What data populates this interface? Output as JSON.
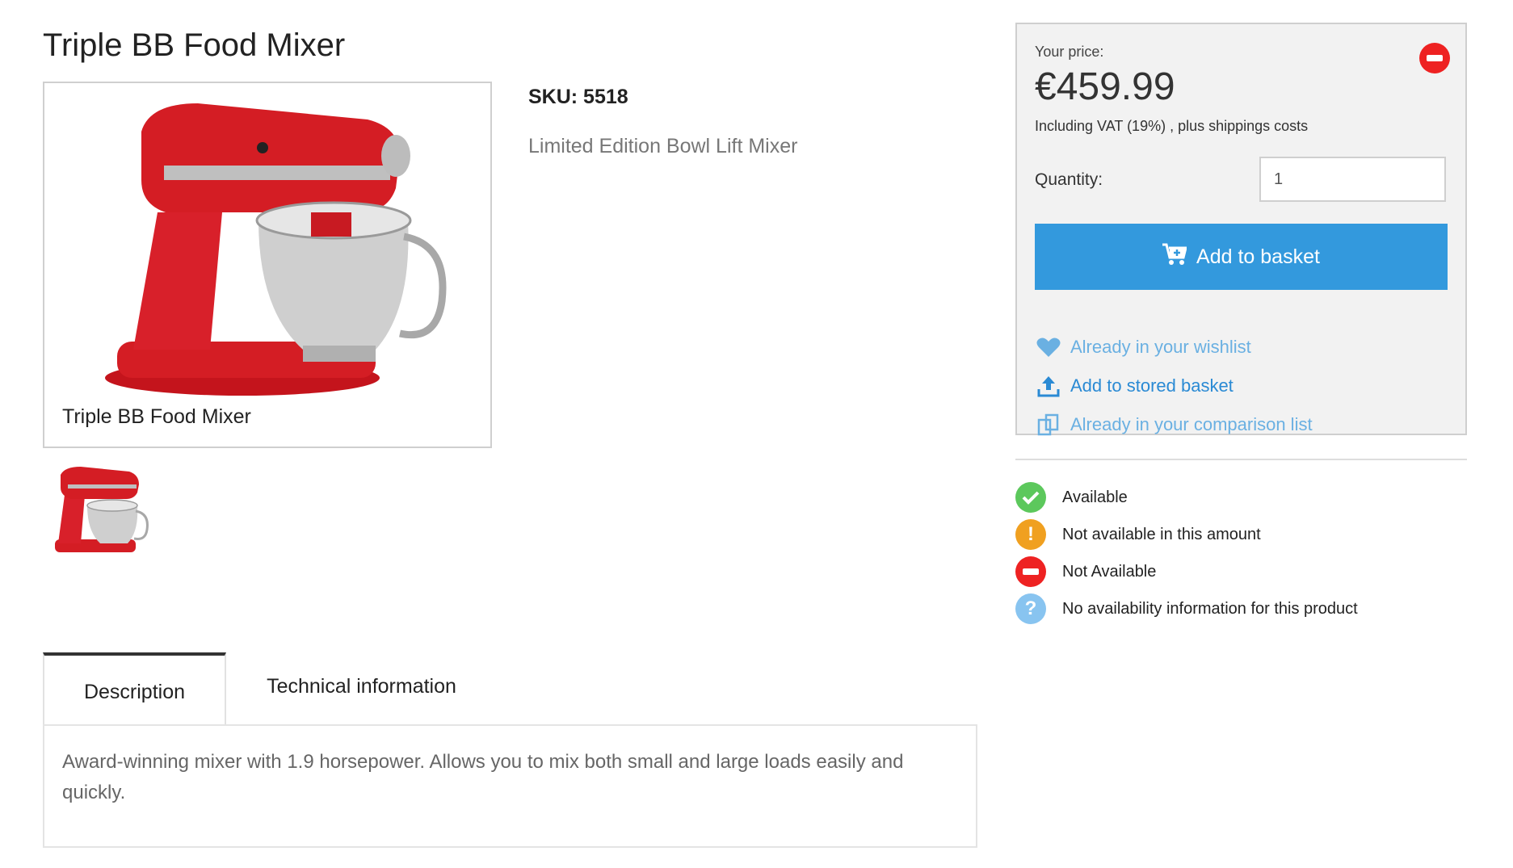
{
  "product": {
    "title": "Triple BB Food Mixer",
    "image_caption": "Triple BB Food Mixer",
    "sku": "SKU: 5518",
    "subtitle": "Limited Edition Bowl Lift Mixer"
  },
  "price_panel": {
    "price_label": "Your price:",
    "price": "€459.99",
    "vat_note": "Including VAT (19%) , plus shippings costs",
    "quantity_label": "Quantity:",
    "quantity_value": "1",
    "add_to_basket": "Add to basket",
    "wishlist_link": "Already in your wishlist",
    "stored_basket_link": "Add to stored basket",
    "comparison_link": "Already in your comparison list",
    "status_icon": "not-available-icon"
  },
  "availability_legend": [
    {
      "label": "Available",
      "icon": "check-icon",
      "color": "#5cc85c"
    },
    {
      "label": "Not available in this amount",
      "icon": "exclamation-icon",
      "color": "#f0a020"
    },
    {
      "label": "Not Available",
      "icon": "minus-icon",
      "color": "#ee2222"
    },
    {
      "label": "No availability information for this product",
      "icon": "question-icon",
      "color": "#88c4f0"
    }
  ],
  "tabs": [
    {
      "label": "Description",
      "active": true
    },
    {
      "label": "Technical information",
      "active": false
    }
  ],
  "description": "Award-winning mixer with 1.9 horsepower. Allows you to mix both small and large loads easily and quickly.",
  "colors": {
    "accent": "#3399dd",
    "link": "#2a8ad4",
    "link_muted": "#6ab0e2",
    "panel_bg": "#f2f2f2"
  }
}
